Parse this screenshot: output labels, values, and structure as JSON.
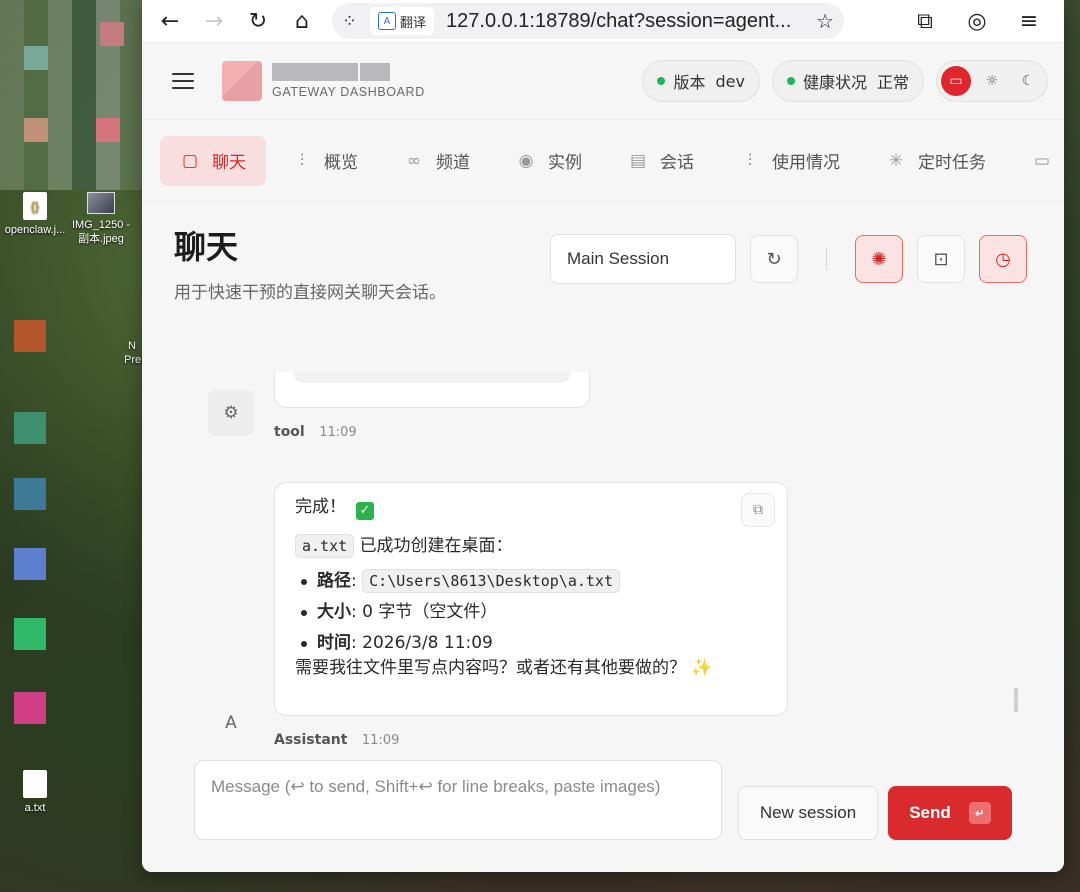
{
  "desktop": {
    "icons": [
      {
        "label": "openclaw.j...",
        "kind": "json"
      },
      {
        "label": "IMG_1250 - 副本.jpeg",
        "kind": "photo"
      },
      {
        "label": "a.txt",
        "kind": "text"
      }
    ],
    "partial_label_1": "N",
    "partial_label_2": "Pre"
  },
  "browser": {
    "back_icon": "back-arrow-icon",
    "forward_icon": "forward-arrow-icon",
    "reload_icon": "reload-icon",
    "home_icon": "home-icon",
    "translate_label": "翻译",
    "url": "127.0.0.1:18789/chat?session=agent...",
    "extensions_icon": "puzzle-icon",
    "profile_icon": "profile-icon",
    "menu_icon": "menu-lines-icon"
  },
  "header": {
    "brand_sub": "GATEWAY DASHBOARD",
    "version_label": "版本",
    "version_value": "dev",
    "health_label": "健康状况",
    "health_value": "正常",
    "status_color": "#1fb55a",
    "accent_color": "#d92a2d"
  },
  "tabs": [
    {
      "label": "聊天",
      "icon": "chat-icon",
      "active": true
    },
    {
      "label": "概览",
      "icon": "bar-chart-icon",
      "active": false
    },
    {
      "label": "频道",
      "icon": "link-icon",
      "active": false
    },
    {
      "label": "实例",
      "icon": "radio-icon",
      "active": false
    },
    {
      "label": "会话",
      "icon": "document-icon",
      "active": false
    },
    {
      "label": "使用情况",
      "icon": "bar-chart-icon",
      "active": false
    },
    {
      "label": "定时任务",
      "icon": "loader-icon",
      "active": false
    }
  ],
  "page": {
    "title": "聊天",
    "description": "用于快速干预的直接网关聊天会话。",
    "session_select": "Main Session"
  },
  "messages": {
    "tool": {
      "sender": "tool",
      "time": "11:09"
    },
    "assistant": {
      "sender": "Assistant",
      "time": "11:09",
      "avatar": "A",
      "done_text": "完成！",
      "file_code": "a.txt",
      "created_text": "已成功创建在桌面：",
      "path_label": "路径",
      "path_value": "C:\\Users\\8613\\Desktop\\a.txt",
      "size_label": "大小",
      "size_value": ": 0 字节（空文件）",
      "time_label": "时间",
      "time_value": ": 2026/3/8 11:09",
      "followup": "需要我往文件里写点内容吗？或者还有其他要做的？",
      "sparkle": "✨"
    }
  },
  "composer": {
    "placeholder": "Message (↩ to send, Shift+↩ for line breaks, paste images)",
    "new_session": "New session",
    "send": "Send"
  }
}
